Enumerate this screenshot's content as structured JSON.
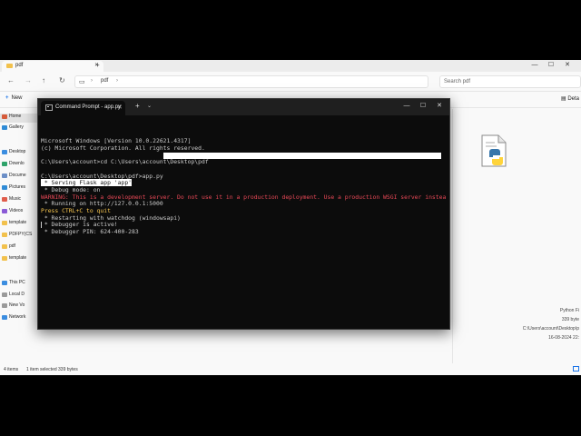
{
  "explorer": {
    "tab": {
      "title": "pdf"
    },
    "path": {
      "segment": "pdf"
    },
    "search": {
      "placeholder": "Search pdf"
    },
    "toolbar": {
      "new_label": "New",
      "details_label": "Deta"
    },
    "sidebar": {
      "items": [
        {
          "label": "Home",
          "color": "#d65b3b"
        },
        {
          "label": "Gallery",
          "color": "#2f8bd6"
        },
        {
          "label": "Desktop",
          "color": "#3b8de0"
        },
        {
          "label": "Downlo",
          "color": "#2fa36a"
        },
        {
          "label": "Docume",
          "color": "#6c8fc7"
        },
        {
          "label": "Pictures",
          "color": "#2f8bd6"
        },
        {
          "label": "Music",
          "color": "#e05d4c"
        },
        {
          "label": "Videos",
          "color": "#8b5bd6"
        },
        {
          "label": "template",
          "color": "#f2c14c"
        },
        {
          "label": "PDFPY(CS",
          "color": "#f2c14c"
        },
        {
          "label": "pdf",
          "color": "#f2c14c"
        },
        {
          "label": "template",
          "color": "#f2c14c"
        },
        {
          "label": "This PC",
          "color": "#3b8de0"
        },
        {
          "label": "Local D",
          "color": "#9a9a9a"
        },
        {
          "label": "New Vo",
          "color": "#9a9a9a"
        },
        {
          "label": "Network",
          "color": "#3b8de0"
        }
      ]
    },
    "details_pane": {
      "type": "Python Fi",
      "size": "339 byte",
      "path": "C:\\Users\\account\\Desktop\\p",
      "date": "16-08-2024 22:"
    },
    "status": {
      "count": "4 items",
      "selection": "1 item selected  339 bytes"
    }
  },
  "cmd": {
    "tab_title": "Command Prompt - app.py",
    "lines": [
      {
        "text": "Microsoft Windows [Version 10.0.22621.4317]",
        "style": "normal"
      },
      {
        "text": "(c) Microsoft Corporation. All rights reserved.",
        "style": "normal"
      },
      {
        "text": "",
        "style": "normal"
      },
      {
        "text": "C:\\Users\\account>cd C:\\Users\\account\\Desktop\\pdf",
        "style": "normal"
      },
      {
        "text": "",
        "style": "normal"
      },
      {
        "text": "C:\\Users\\account\\Desktop\\pdf>app.py",
        "style": "normal"
      },
      {
        "text": " * Serving Flask app 'app'",
        "style": "normal"
      },
      {
        "text": " * Debug mode: on",
        "style": "normal"
      },
      {
        "text": "WARNING: This is a development server. Do not use it in a production deployment. Use a production WSGI server instead.",
        "style": "warn"
      },
      {
        "text": " * Running on http://127.0.0.1:5000",
        "style": "normal"
      },
      {
        "text": "Press CTRL+C to quit",
        "style": "yellow"
      },
      {
        "text": " * Restarting with watchdog (windowsapi)",
        "style": "normal"
      },
      {
        "text": " * Debugger is active!",
        "style": "normal"
      },
      {
        "text": " * Debugger PIN: 624-400-283",
        "style": "normal"
      }
    ]
  },
  "colors": {
    "terminal_bg": "#0c0c0c",
    "terminal_text": "#cccccc",
    "warning": "#e74856",
    "ctrl_c": "#f9c74f",
    "accent": "#1a73e8"
  }
}
